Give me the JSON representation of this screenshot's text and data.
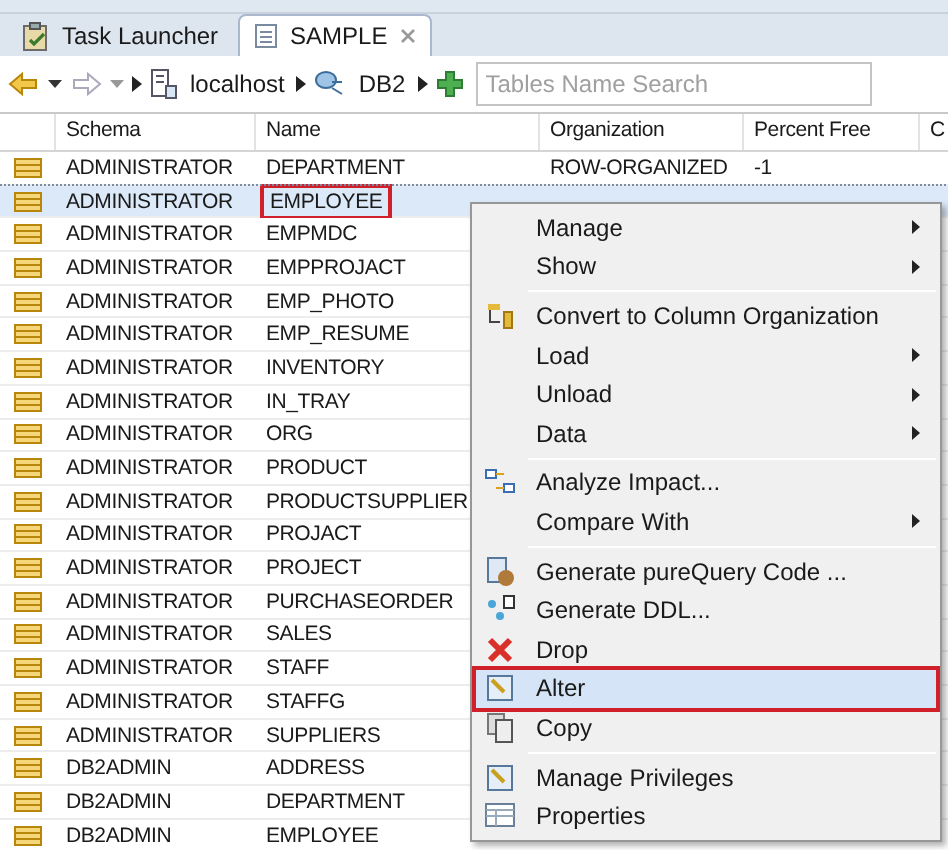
{
  "tabs": [
    {
      "label": "Task Launcher",
      "selected": false,
      "closable": false
    },
    {
      "label": "SAMPLE",
      "selected": true,
      "closable": true
    }
  ],
  "toolbar": {
    "breadcrumb": [
      "localhost",
      "DB2"
    ],
    "search": {
      "placeholder": "Tables Name Search"
    }
  },
  "table": {
    "columns": [
      "Schema",
      "Name",
      "Organization",
      "Percent Free",
      "C"
    ],
    "rows": [
      {
        "schema": "ADMINISTRATOR",
        "name": "DEPARTMENT",
        "organization": "ROW-ORGANIZED",
        "percent_free": "-1",
        "selected": false,
        "outlined": false
      },
      {
        "schema": "ADMINISTRATOR",
        "name": "EMPLOYEE",
        "selected": true,
        "outlined": true
      },
      {
        "schema": "ADMINISTRATOR",
        "name": "EMPMDC",
        "selected": false,
        "outlined": false
      },
      {
        "schema": "ADMINISTRATOR",
        "name": "EMPPROJACT",
        "selected": false,
        "outlined": false
      },
      {
        "schema": "ADMINISTRATOR",
        "name": "EMP_PHOTO",
        "selected": false,
        "outlined": false
      },
      {
        "schema": "ADMINISTRATOR",
        "name": "EMP_RESUME",
        "selected": false,
        "outlined": false
      },
      {
        "schema": "ADMINISTRATOR",
        "name": "INVENTORY",
        "selected": false,
        "outlined": false
      },
      {
        "schema": "ADMINISTRATOR",
        "name": "IN_TRAY",
        "selected": false,
        "outlined": false
      },
      {
        "schema": "ADMINISTRATOR",
        "name": "ORG",
        "selected": false,
        "outlined": false
      },
      {
        "schema": "ADMINISTRATOR",
        "name": "PRODUCT",
        "selected": false,
        "outlined": false
      },
      {
        "schema": "ADMINISTRATOR",
        "name": "PRODUCTSUPPLIER",
        "selected": false,
        "outlined": false
      },
      {
        "schema": "ADMINISTRATOR",
        "name": "PROJACT",
        "selected": false,
        "outlined": false
      },
      {
        "schema": "ADMINISTRATOR",
        "name": "PROJECT",
        "selected": false,
        "outlined": false
      },
      {
        "schema": "ADMINISTRATOR",
        "name": "PURCHASEORDER",
        "selected": false,
        "outlined": false
      },
      {
        "schema": "ADMINISTRATOR",
        "name": "SALES",
        "selected": false,
        "outlined": false
      },
      {
        "schema": "ADMINISTRATOR",
        "name": "STAFF",
        "selected": false,
        "outlined": false
      },
      {
        "schema": "ADMINISTRATOR",
        "name": "STAFFG",
        "selected": false,
        "outlined": false
      },
      {
        "schema": "ADMINISTRATOR",
        "name": "SUPPLIERS",
        "selected": false,
        "outlined": false
      },
      {
        "schema": "DB2ADMIN",
        "name": "ADDRESS",
        "selected": false,
        "outlined": false
      },
      {
        "schema": "DB2ADMIN",
        "name": "DEPARTMENT",
        "selected": false,
        "outlined": false
      },
      {
        "schema": "DB2ADMIN",
        "name": "EMPLOYEE",
        "selected": false,
        "outlined": false
      }
    ]
  },
  "context_menu": [
    {
      "kind": "item",
      "label": "Manage",
      "submenu": true,
      "selected": false,
      "outlined": false
    },
    {
      "kind": "item",
      "label": "Show",
      "submenu": true,
      "selected": false,
      "outlined": false
    },
    {
      "kind": "separator"
    },
    {
      "kind": "item",
      "label": "Convert to Column Organization",
      "submenu": false,
      "selected": false,
      "outlined": false
    },
    {
      "kind": "item",
      "label": "Load",
      "submenu": true,
      "selected": false,
      "outlined": false
    },
    {
      "kind": "item",
      "label": "Unload",
      "submenu": true,
      "selected": false,
      "outlined": false
    },
    {
      "kind": "item",
      "label": "Data",
      "submenu": true,
      "selected": false,
      "outlined": false
    },
    {
      "kind": "separator"
    },
    {
      "kind": "item",
      "label": "Analyze Impact...",
      "submenu": false,
      "selected": false,
      "outlined": false
    },
    {
      "kind": "item",
      "label": "Compare With",
      "submenu": true,
      "selected": false,
      "outlined": false
    },
    {
      "kind": "separator"
    },
    {
      "kind": "item",
      "label": "Generate pureQuery Code ...",
      "submenu": false,
      "selected": false,
      "outlined": false
    },
    {
      "kind": "item",
      "label": "Generate DDL...",
      "submenu": false,
      "selected": false,
      "outlined": false
    },
    {
      "kind": "item",
      "label": "Drop",
      "submenu": false,
      "selected": false,
      "outlined": false
    },
    {
      "kind": "item",
      "label": "Alter",
      "submenu": false,
      "selected": true,
      "outlined": true
    },
    {
      "kind": "item",
      "label": "Copy",
      "submenu": false,
      "selected": false,
      "outlined": false
    },
    {
      "kind": "separator"
    },
    {
      "kind": "item",
      "label": "Manage Privileges",
      "submenu": false,
      "selected": false,
      "outlined": false
    },
    {
      "kind": "item",
      "label": "Properties",
      "submenu": false,
      "selected": false,
      "outlined": false
    }
  ]
}
